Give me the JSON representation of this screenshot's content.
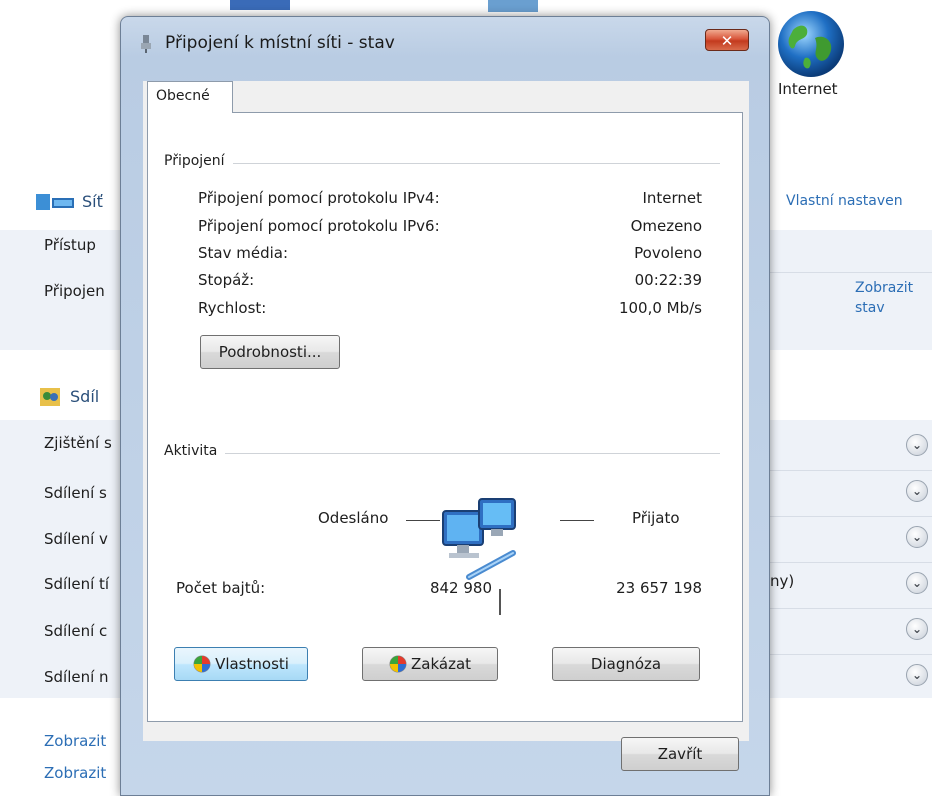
{
  "background": {
    "internet_label": "Internet",
    "network_label": "Síť",
    "custom_link": "Vlastní nastaven",
    "access_label": "Přístup",
    "connections_label": "Připojen",
    "show_status_link_line1": "Zobrazit",
    "show_status_link_line2": "stav",
    "sharing_heading": "Sdíl",
    "rows": [
      "Zjištění s",
      "Sdílení s",
      "Sdílení v",
      "Sdílení tí",
      "Sdílení c",
      "Sdílení n"
    ],
    "partial_text": "ny)",
    "bottom_link1": "Zobrazit",
    "bottom_link2": "Zobrazit"
  },
  "dialog": {
    "title": "Připojení k místní síti - stav",
    "close_symbol": "✕",
    "tab_label": "Obecné",
    "connection_group": {
      "title": "Připojení",
      "rows": [
        {
          "label": "Připojení pomocí protokolu IPv4:",
          "value": "Internet"
        },
        {
          "label": "Připojení pomocí protokolu IPv6:",
          "value": "Omezeno"
        },
        {
          "label": "Stav média:",
          "value": "Povoleno"
        },
        {
          "label": "Stopáž:",
          "value": "00:22:39"
        },
        {
          "label": "Rychlost:",
          "value": "100,0 Mb/s"
        }
      ],
      "details_button": "Podrobnosti..."
    },
    "activity_group": {
      "title": "Aktivita",
      "sent_label": "Odesláno",
      "received_label": "Přijato",
      "bytes_label": "Počet bajtů:",
      "bytes_sent": "842 980",
      "bytes_received": "23 657 198"
    },
    "buttons": {
      "properties": "Vlastnosti",
      "disable": "Zakázat",
      "diagnose": "Diagnóza",
      "close": "Zavřít"
    }
  },
  "colors": {
    "link": "#2c6eb5",
    "close_button": "#c33a1e",
    "focused_button": "#bee6fd"
  }
}
